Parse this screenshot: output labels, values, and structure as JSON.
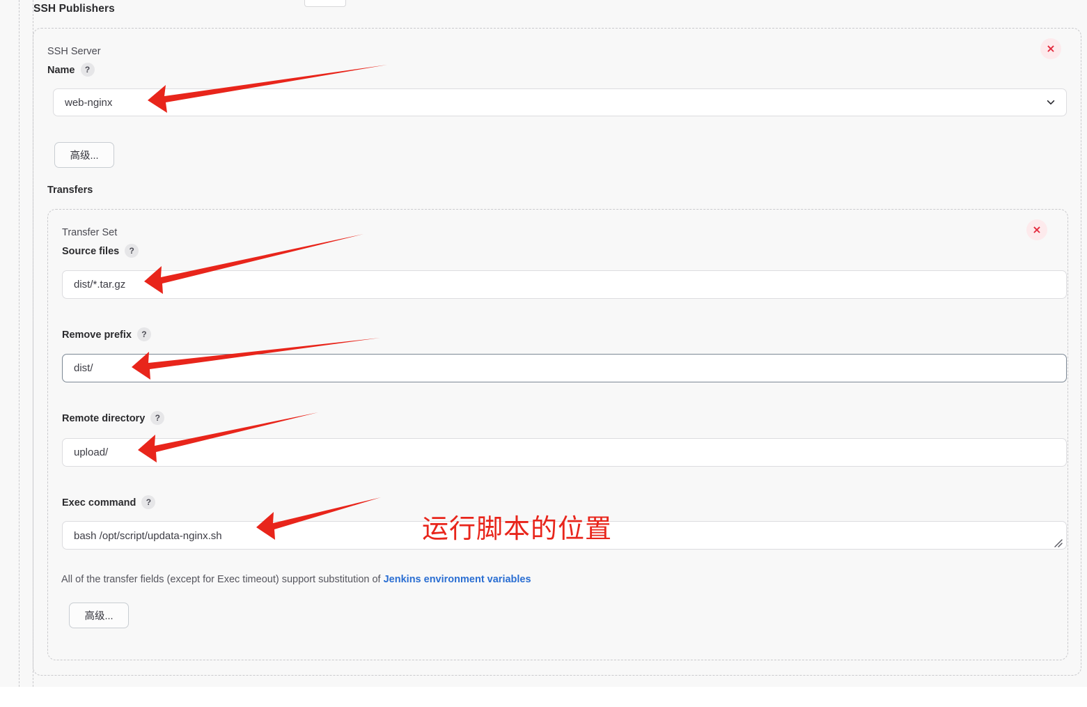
{
  "section": {
    "title": "SSH Publishers"
  },
  "publisher": {
    "delete_label": "×",
    "server_group_label": "SSH Server",
    "name_label": "Name",
    "name_help": "?",
    "name_value": "web-nginx",
    "dropdown_icon": "chevron-down-icon",
    "advanced_label": "高级...",
    "transfers_label": "Transfers"
  },
  "transfer_set": {
    "delete_label": "×",
    "group_label": "Transfer Set",
    "source_files": {
      "label": "Source files",
      "help": "?",
      "value": "dist/*.tar.gz"
    },
    "remove_prefix": {
      "label": "Remove prefix",
      "help": "?",
      "value": "dist/"
    },
    "remote_directory": {
      "label": "Remote directory",
      "help": "?",
      "value": "upload/"
    },
    "exec_command": {
      "label": "Exec command",
      "help": "?",
      "value": "bash /opt/script/updata-nginx.sh"
    },
    "note_prefix": "All of the transfer fields (except for Exec timeout) support substitution of ",
    "note_link": "Jenkins environment variables",
    "advanced_label": "高级..."
  },
  "annotations": {
    "script_location_text": "运行脚本的位置",
    "arrow_color": "#e8251b",
    "count": 5
  },
  "colors": {
    "page_background": "#f8f8f8",
    "panel_border": "#c9c9cc",
    "input_border": "#dcdcdf",
    "input_focus_border": "#7b8794",
    "link": "#2a6ed2",
    "delete_icon": "#e3293c",
    "delete_background": "#fdeaec",
    "annotation_red": "#e8251b"
  }
}
